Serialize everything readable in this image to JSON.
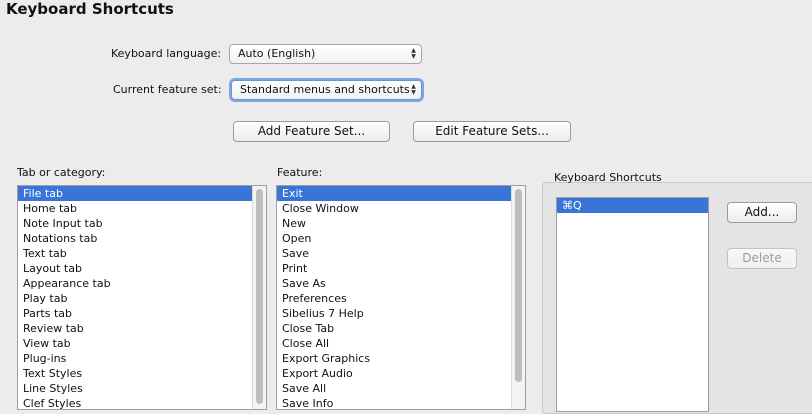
{
  "header": {
    "title": "Keyboard Shortcuts"
  },
  "form": {
    "keyboard_language_label": "Keyboard language:",
    "keyboard_language_value": "Auto (English)",
    "feature_set_label": "Current feature set:",
    "feature_set_value": "Standard menus and shortcuts"
  },
  "buttons": {
    "add_feature_set": "Add Feature Set...",
    "edit_feature_sets": "Edit Feature Sets..."
  },
  "categories": {
    "label": "Tab or category:",
    "items": [
      "File tab",
      "Home tab",
      "Note Input tab",
      "Notations tab",
      "Text tab",
      "Layout tab",
      "Appearance tab",
      "Play tab",
      "Parts tab",
      "Review tab",
      "View tab",
      "Plug-ins",
      "Text Styles",
      "Line Styles",
      "Clef Styles"
    ],
    "selected": 0
  },
  "features": {
    "label": "Feature:",
    "items": [
      "Exit",
      "Close Window",
      "New",
      "Open",
      "Save",
      "Print",
      "Save As",
      "Preferences",
      "Sibelius 7 Help",
      "Close Tab",
      "Close All",
      "Export Graphics",
      "Export Audio",
      "Save All",
      "Save Info"
    ],
    "selected": 0
  },
  "shortcuts": {
    "label": "Keyboard Shortcuts",
    "items": [
      "⌘Q"
    ],
    "selected": 0,
    "add_label": "Add...",
    "delete_label": "Delete"
  },
  "icons": {
    "popup_arrows": "▲▼"
  }
}
